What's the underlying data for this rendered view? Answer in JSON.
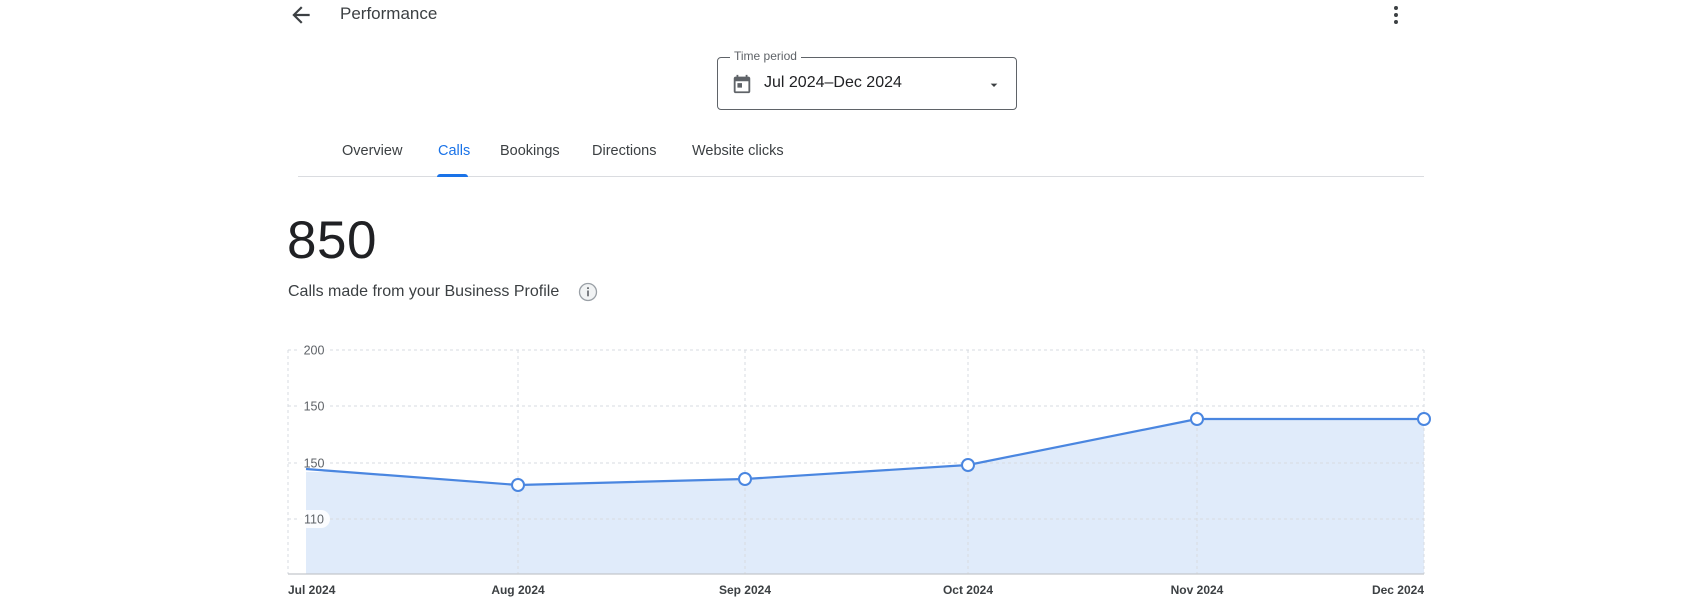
{
  "header": {
    "title": "Performance",
    "back_icon": "arrow-back-icon",
    "more_icon": "more-vert-icon"
  },
  "time_period": {
    "label": "Time period",
    "value": "Jul 2024–Dec 2024",
    "icon": "calendar-icon",
    "dropdown_icon": "arrow-drop-down-icon"
  },
  "tabs": [
    {
      "label": "Overview"
    },
    {
      "label": "Calls",
      "active": true
    },
    {
      "label": "Bookings"
    },
    {
      "label": "Directions"
    },
    {
      "label": "Website clicks"
    }
  ],
  "metric": {
    "value": "850",
    "description": "Calls made from your Business Profile",
    "info_icon": "info-icon"
  },
  "colors": {
    "accent": "#1a73e8",
    "line": "#4a86e0",
    "area": "#e0ebfa"
  },
  "chart_data": {
    "type": "area",
    "categories": [
      "Jul 2024",
      "Aug 2024",
      "Sep 2024",
      "Oct 2024",
      "Nov 2024",
      "Dec 2024"
    ],
    "values": [
      150,
      142,
      145,
      152,
      175,
      175
    ],
    "yticks": [
      "200",
      "150",
      "150",
      "110"
    ],
    "grid": true,
    "markers": [
      false,
      true,
      true,
      true,
      true,
      true
    ]
  }
}
